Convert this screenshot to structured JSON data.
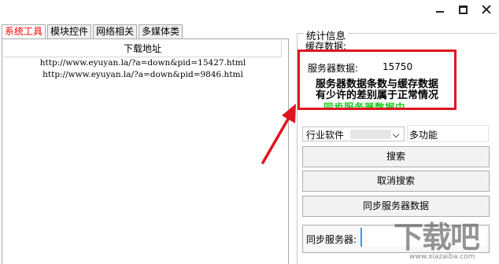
{
  "window_controls": {
    "minimize": "minimize",
    "maximize": "maximize",
    "close": "close"
  },
  "tabs": [
    {
      "label": "系统工具",
      "active": true
    },
    {
      "label": "模块控件",
      "active": false
    },
    {
      "label": "网络相关",
      "active": false
    },
    {
      "label": "多媒体类",
      "active": false
    }
  ],
  "list": {
    "header": "下载地址",
    "rows": [
      "http://www.eyuyan.la/?a=down&pid=15427.html",
      "http://www.eyuyan.la/?a=down&pid=9846.html"
    ]
  },
  "stats": {
    "group_title": "统计信息",
    "cache_label": "缓存数据:",
    "server_label": "服务器数据:",
    "server_count": "15750",
    "warning_line1": "服务器数据条数与缓存数据",
    "warning_line2": "有少许的差别属于正常情况",
    "sync_status": "同步服务器数据中..."
  },
  "category": {
    "selected": "行业软件",
    "side_text": "多功能"
  },
  "buttons": {
    "search": "搜索",
    "cancel_search": "取消搜索",
    "sync_data": "同步服务器数据"
  },
  "sync_server": {
    "label": "同步服务器:",
    "value": ""
  },
  "watermark": {
    "big": "下载吧",
    "small": "www.xiazaiba.com"
  },
  "colors": {
    "highlight_border": "#e0141e",
    "active_tab": "#ff0000",
    "sync_status": "#1ec81e",
    "arrow": "#e0141e"
  }
}
